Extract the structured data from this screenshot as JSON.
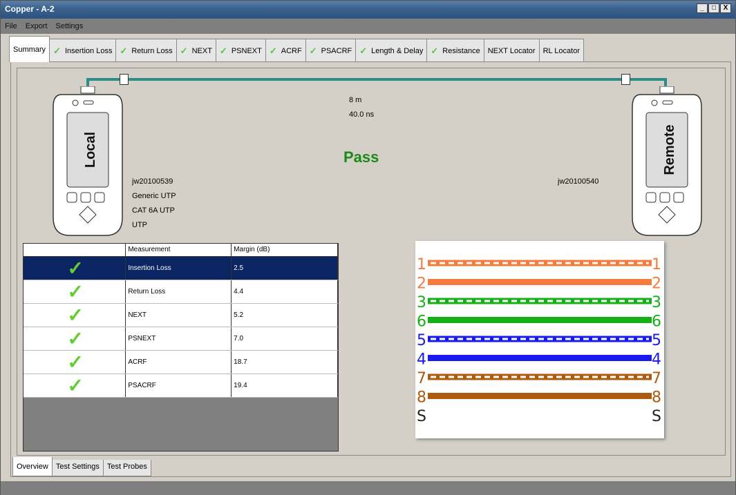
{
  "window": {
    "title": "Copper - A-2",
    "buttons": [
      "_",
      "□",
      "X"
    ]
  },
  "menu": [
    "File",
    "Export",
    "Settings"
  ],
  "tabs": [
    {
      "label": "Summary",
      "check": false
    },
    {
      "label": "Insertion Loss",
      "check": true
    },
    {
      "label": "Return Loss",
      "check": true
    },
    {
      "label": "NEXT",
      "check": true
    },
    {
      "label": "PSNEXT",
      "check": true
    },
    {
      "label": "ACRF",
      "check": true
    },
    {
      "label": "PSACRF",
      "check": true
    },
    {
      "label": "Length & Delay",
      "check": true
    },
    {
      "label": "Resistance",
      "check": true
    },
    {
      "label": "NEXT Locator",
      "check": false
    },
    {
      "label": "RL Locator",
      "check": false
    }
  ],
  "check_glyph": "✓",
  "summary": {
    "length": "8 m",
    "delay": "40.0 ns",
    "result": "Pass",
    "local": {
      "label": "Local",
      "serial": "jw20100539",
      "lines": [
        "Generic UTP",
        "CAT 6A UTP",
        "UTP"
      ]
    },
    "remote": {
      "label": "Remote",
      "serial": "jw20100540"
    }
  },
  "results_table": {
    "headers": [
      "",
      "Measurement",
      "Margin (dB)"
    ],
    "rows": [
      {
        "measurement": "Insertion Loss",
        "margin": "2.5"
      },
      {
        "measurement": "Return Loss",
        "margin": "4.4"
      },
      {
        "measurement": "NEXT",
        "margin": "5.2"
      },
      {
        "measurement": "PSNEXT",
        "margin": "7.0"
      },
      {
        "measurement": "ACRF",
        "margin": "18.7"
      },
      {
        "measurement": "PSACRF",
        "margin": "19.4"
      }
    ]
  },
  "wiremap": {
    "pairs": [
      {
        "pin": "1",
        "color": "#f47c3c",
        "style": "dashed"
      },
      {
        "pin": "2",
        "color": "#f47c3c",
        "style": "solid"
      },
      {
        "pin": "3",
        "color": "#16b016",
        "style": "dashed"
      },
      {
        "pin": "6",
        "color": "#16b016",
        "style": "solid"
      },
      {
        "pin": "5",
        "color": "#1a1aee",
        "style": "dashed"
      },
      {
        "pin": "4",
        "color": "#1a1aee",
        "style": "solid"
      },
      {
        "pin": "7",
        "color": "#b05a10",
        "style": "dashed"
      },
      {
        "pin": "8",
        "color": "#b05a10",
        "style": "solid"
      },
      {
        "pin": "S",
        "color": "#222222",
        "style": "none"
      }
    ]
  },
  "bottom_tabs": [
    "Overview",
    "Test Settings",
    "Test Probes"
  ]
}
